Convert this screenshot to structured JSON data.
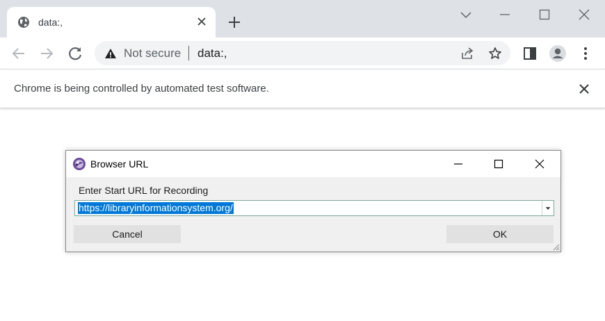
{
  "browser": {
    "tab": {
      "title": "data:,",
      "favicon": "globe-icon"
    },
    "omnibox": {
      "security_text": "Not secure",
      "url": "data:,"
    },
    "infobar": {
      "message": "Chrome is being controlled by automated test software."
    }
  },
  "dialog": {
    "title": "Browser URL",
    "prompt_label": "Enter Start URL for Recording",
    "url_value": "https://libraryinformationsystem.org/",
    "cancel_label": "Cancel",
    "ok_label": "OK"
  },
  "colors": {
    "tabstrip_bg": "#dee1e6",
    "omnibox_bg": "#f1f3f4",
    "selection_bg": "#0078d7",
    "dialog_bg": "#f0f0f0"
  }
}
